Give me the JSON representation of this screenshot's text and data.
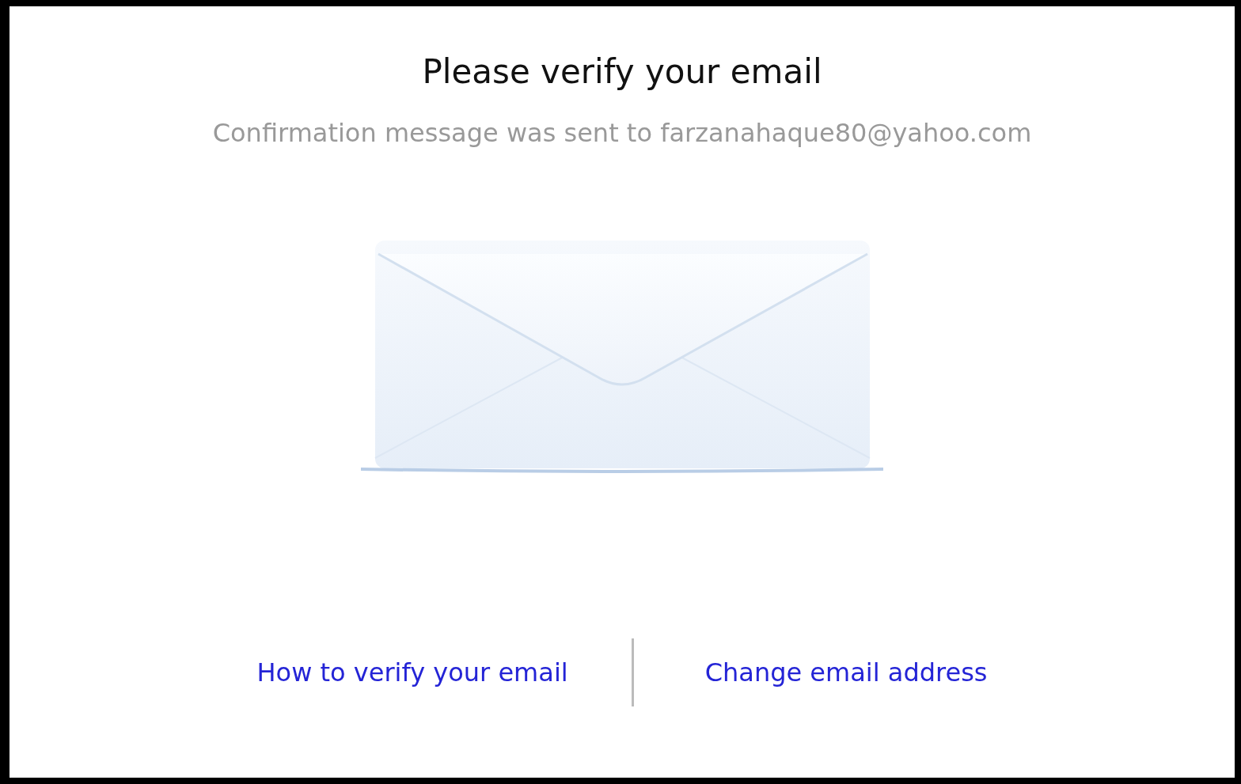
{
  "title": "Please verify your email",
  "message": "Confirmation message was sent to farzanahaque80@yahoo.com",
  "links": [
    {
      "label": "How to verify your email"
    },
    {
      "label": "Change email address"
    }
  ]
}
